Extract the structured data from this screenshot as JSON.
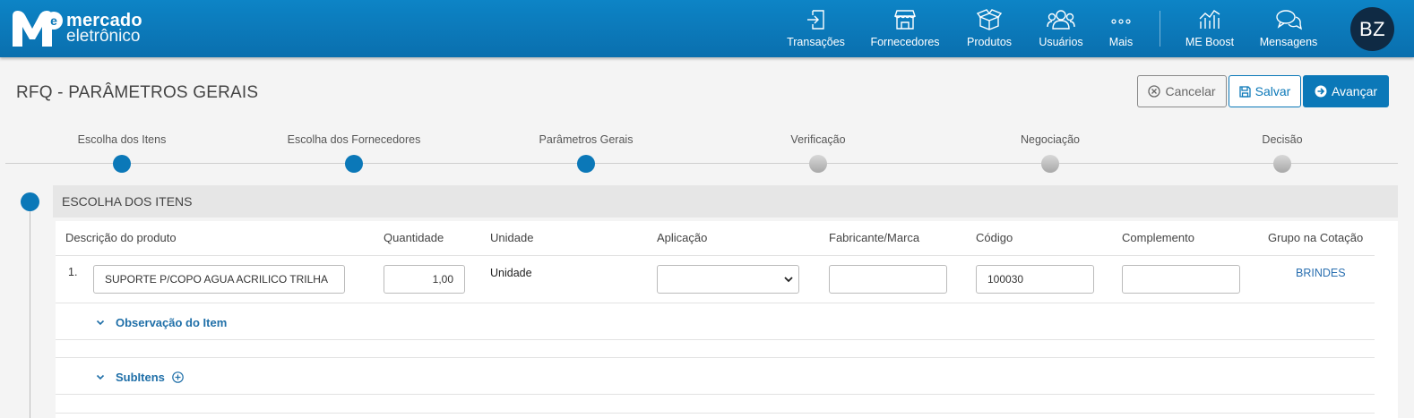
{
  "header": {
    "logo_line1": "mercado",
    "logo_line2": "eletrônico",
    "nav": [
      {
        "label": "Transações",
        "icon": "transactions-icon"
      },
      {
        "label": "Fornecedores",
        "icon": "store-icon"
      },
      {
        "label": "Produtos",
        "icon": "box-icon"
      },
      {
        "label": "Usuários",
        "icon": "users-icon"
      },
      {
        "label": "Mais",
        "icon": "more-icon"
      },
      {
        "label": "ME Boost",
        "icon": "chart-icon"
      },
      {
        "label": "Mensagens",
        "icon": "chat-icon"
      }
    ],
    "avatar_initials": "BZ",
    "brand_color": "#0b78b8"
  },
  "page": {
    "title": "RFQ - PARÂMETROS GERAIS",
    "cancel_label": "Cancelar",
    "save_label": "Salvar",
    "next_label": "Avançar"
  },
  "stepper": [
    {
      "label": "Escolha dos Itens",
      "state": "done"
    },
    {
      "label": "Escolha dos Fornecedores",
      "state": "done"
    },
    {
      "label": "Parâmetros Gerais",
      "state": "done"
    },
    {
      "label": "Verificação",
      "state": "todo"
    },
    {
      "label": "Negociação",
      "state": "todo"
    },
    {
      "label": "Decisão",
      "state": "todo"
    }
  ],
  "section": {
    "title": "ESCOLHA DOS ITENS",
    "columns": [
      "Descrição do produto",
      "Quantidade",
      "Unidade",
      "Aplicação",
      "Fabricante/Marca",
      "Código",
      "Complemento",
      "Grupo na Cotação"
    ],
    "item": {
      "number": "1.",
      "description": "SUPORTE P/COPO AGUA ACRILICO TRILHA",
      "quantity": "1,00",
      "unit": "Unidade",
      "application": "",
      "manufacturer": "",
      "code": "100030",
      "complement": "",
      "group": "BRINDES"
    },
    "observation_label": "Observação do Item",
    "subitems_label": "SubItens"
  }
}
